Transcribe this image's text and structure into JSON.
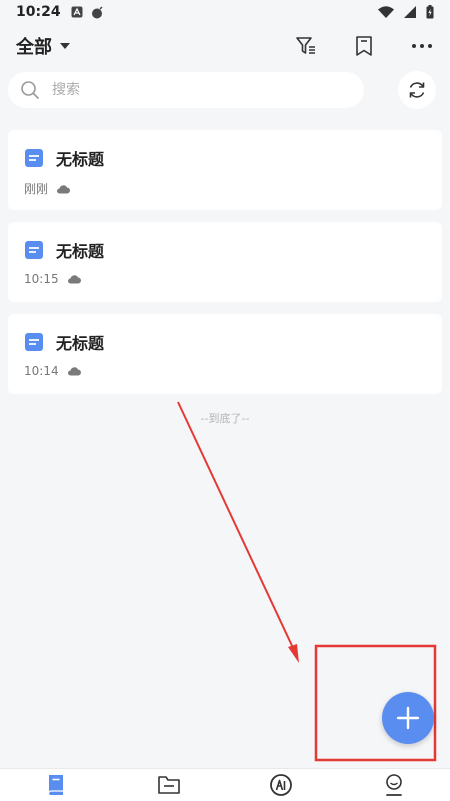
{
  "status_bar": {
    "time": "10:24"
  },
  "header": {
    "scope_label": "全部"
  },
  "search": {
    "placeholder": "搜索"
  },
  "notes": [
    {
      "title": "无标题",
      "time": "刚刚"
    },
    {
      "title": "无标题",
      "time": "10:15"
    },
    {
      "title": "无标题",
      "time": "10:14"
    }
  ],
  "list_end_label": "--到底了--",
  "colors": {
    "accent": "#5a8df0",
    "doc_icon": "#5a8df0",
    "annotation": "#e53935"
  }
}
